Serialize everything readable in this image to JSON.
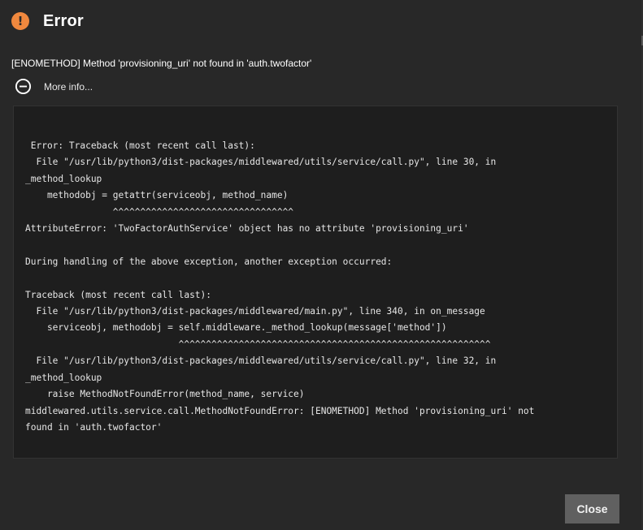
{
  "dialog": {
    "title": "Error",
    "message": "[ENOMETHOD] Method 'provisioning_uri' not found in 'auth.twofactor'",
    "more_info_label": "More info...",
    "close_label": "Close",
    "icons": {
      "status": "warning-circle-icon",
      "more_info": "collapse-minus-circle-icon"
    },
    "colors": {
      "warning": "#f0883e",
      "background": "#282828",
      "trace_background": "#1e1e1e",
      "button": "#606060"
    }
  },
  "traceback": {
    "text": " Error: Traceback (most recent call last):\n  File \"/usr/lib/python3/dist-packages/middlewared/utils/service/call.py\", line 30, in\n_method_lookup\n    methodobj = getattr(serviceobj, method_name)\n                ^^^^^^^^^^^^^^^^^^^^^^^^^^^^^^^^^\nAttributeError: 'TwoFactorAuthService' object has no attribute 'provisioning_uri'\n\nDuring handling of the above exception, another exception occurred:\n\nTraceback (most recent call last):\n  File \"/usr/lib/python3/dist-packages/middlewared/main.py\", line 340, in on_message\n    serviceobj, methodobj = self.middleware._method_lookup(message['method'])\n                            ^^^^^^^^^^^^^^^^^^^^^^^^^^^^^^^^^^^^^^^^^^^^^^^^^^^^^^^^^\n  File \"/usr/lib/python3/dist-packages/middlewared/utils/service/call.py\", line 32, in\n_method_lookup\n    raise MethodNotFoundError(method_name, service)\nmiddlewared.utils.service.call.MethodNotFoundError: [ENOMETHOD] Method 'provisioning_uri' not\nfound in 'auth.twofactor'"
  }
}
